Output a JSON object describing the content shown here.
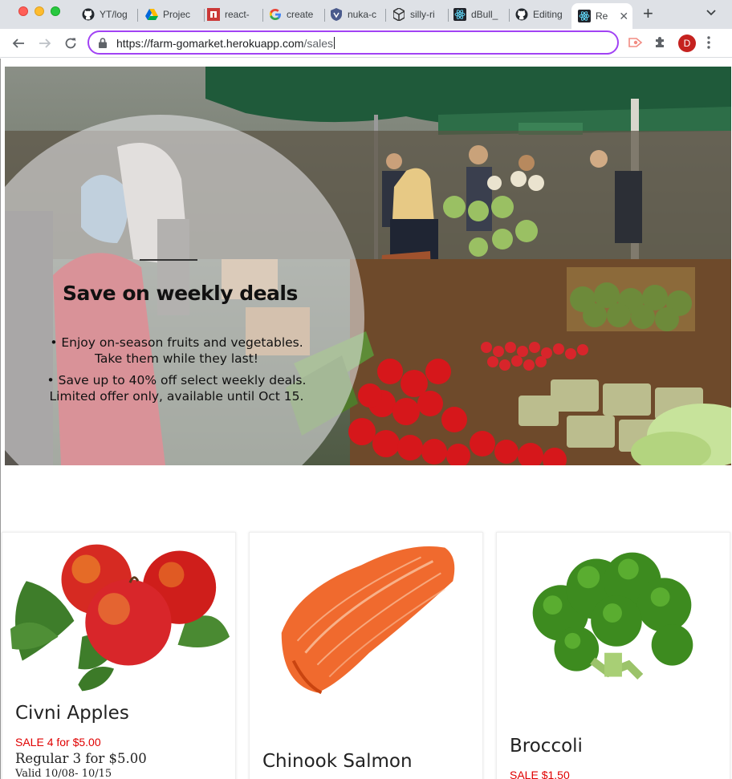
{
  "browser": {
    "tabs": [
      {
        "label": "YT/log",
        "icon": "github-icon"
      },
      {
        "label": "Projec",
        "icon": "google-drive-icon"
      },
      {
        "label": "react-",
        "icon": "npm-icon"
      },
      {
        "label": "create",
        "icon": "google-icon"
      },
      {
        "label": "nuka-c",
        "icon": "shield-icon"
      },
      {
        "label": "silly-ri",
        "icon": "codesandbox-icon"
      },
      {
        "label": "dBull_",
        "icon": "react-icon"
      },
      {
        "label": "Editing",
        "icon": "github-icon"
      },
      {
        "label": "Re",
        "icon": "react-icon",
        "active": true
      }
    ],
    "new_tab": "+",
    "url_host": "https://farm-gomarket.herokuapp.com",
    "url_path": "/sales",
    "profile_initial": "D",
    "accent": "#a142f4"
  },
  "hero": {
    "title": "Save  on weekly deals",
    "bullets": [
      {
        "line1": "•  Enjoy on-season fruits and vegetables.",
        "line2": "Take them while they last!"
      },
      {
        "line1": "•  Save up to 40% off select weekly deals.",
        "line2": "Limited offer only, available until Oct 15."
      }
    ]
  },
  "products": [
    {
      "name": "Civni Apples",
      "sale": "SALE 4 for $5.00",
      "regular": "Regular 3 for $5.00",
      "valid": "Valid 10/08- 10/15",
      "image": "apples-image"
    },
    {
      "name": "Chinook Salmon",
      "image": "salmon-image"
    },
    {
      "name": "Broccoli",
      "sale": "SALE $1.50",
      "image": "broccoli-image"
    }
  ],
  "colors": {
    "sale": "#e00000",
    "profile": "#c5221f"
  }
}
